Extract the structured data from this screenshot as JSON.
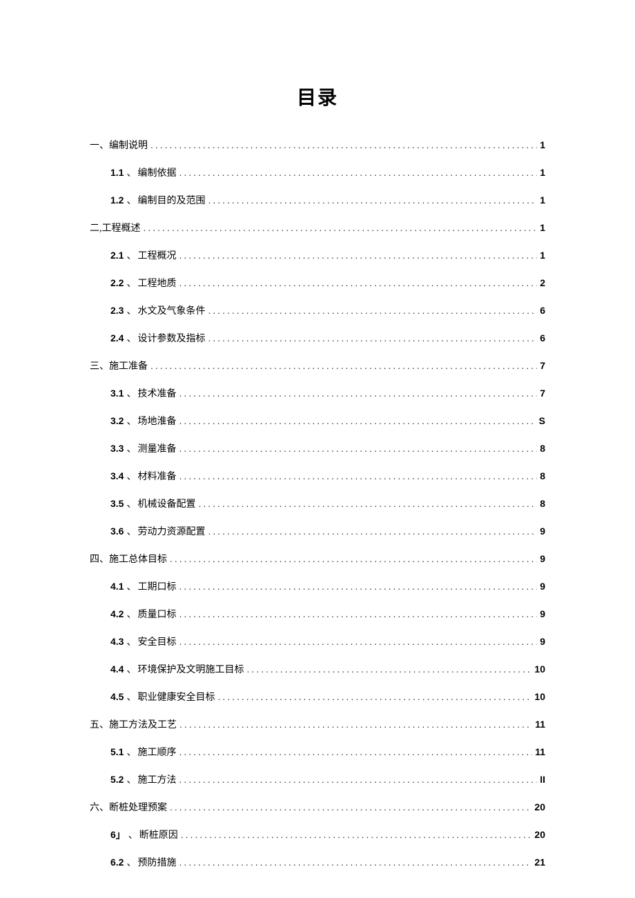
{
  "title": "目录",
  "entries": [
    {
      "level": 1,
      "num": "一、",
      "text": "编制说明",
      "page": "1"
    },
    {
      "level": 2,
      "num": "1.1",
      "sep": "、",
      "text": "编制依据",
      "page": "1"
    },
    {
      "level": 2,
      "num": "1.2",
      "sep": "、",
      "text": "编制目的及范围",
      "page": "1"
    },
    {
      "level": 1,
      "num": "二,",
      "text": "工程概述",
      "page": "1"
    },
    {
      "level": 2,
      "num": "2.1",
      "sep": "、",
      "text": "工程概况",
      "page": "1"
    },
    {
      "level": 2,
      "num": "2.2",
      "sep": "、",
      "text": "工程地质",
      "page": "2"
    },
    {
      "level": 2,
      "num": "2.3",
      "sep": "、",
      "text": "水文及气象条件",
      "page": "6"
    },
    {
      "level": 2,
      "num": "2.4",
      "sep": "、",
      "text": "设计参数及指标",
      "page": "6"
    },
    {
      "level": 1,
      "num": "三、",
      "text": "施工准备",
      "page": "7"
    },
    {
      "level": 2,
      "num": "3.1",
      "sep": "、",
      "text": "技术准备",
      "page": "7"
    },
    {
      "level": 2,
      "num": "3.2",
      "sep": "、",
      "text": "场地淮备",
      "page": "S"
    },
    {
      "level": 2,
      "num": "3.3",
      "sep": "、",
      "text": "测量准备",
      "page": "8"
    },
    {
      "level": 2,
      "num": "3.4",
      "sep": "、",
      "text": "材料准备",
      "page": "8"
    },
    {
      "level": 2,
      "num": "3.5",
      "sep": "、",
      "text": "机械设备配置",
      "page": "8"
    },
    {
      "level": 2,
      "num": "3.6",
      "sep": "、",
      "text": "劳动力资源配置",
      "page": "9"
    },
    {
      "level": 1,
      "num": "四、",
      "text": "施工总体目标",
      "page": "9"
    },
    {
      "level": 2,
      "num": "4.1",
      "sep": "、",
      "text": "工期口标",
      "page": "9"
    },
    {
      "level": 2,
      "num": "4.2",
      "sep": "、",
      "text": "质量口标",
      "page": "9"
    },
    {
      "level": 2,
      "num": "4.3",
      "sep": "、",
      "text": "安全目标",
      "page": "9"
    },
    {
      "level": 2,
      "num": "4.4",
      "sep": "、",
      "text": "环境保护及文明施工目标",
      "page": "10"
    },
    {
      "level": 2,
      "num": "4.5",
      "sep": "、",
      "text": "职业健康安全目标",
      "page": "10"
    },
    {
      "level": 1,
      "num": "五、",
      "text": "施工方法及工艺",
      "page": "11"
    },
    {
      "level": 2,
      "num": "5.1",
      "sep": "、",
      "text": "施工顺序",
      "page": "11"
    },
    {
      "level": 2,
      "num": "5.2",
      "sep": "、",
      "text": "施工方法",
      "page": "II"
    },
    {
      "level": 1,
      "num": "六、",
      "text": "断桩处理预案",
      "page": "20"
    },
    {
      "level": 2,
      "num": "6」",
      "sep": "、",
      "text": "断桩原因",
      "page": "20"
    },
    {
      "level": 2,
      "num": "6.2",
      "sep": "、",
      "text": "预防措施",
      "page": "21"
    }
  ]
}
